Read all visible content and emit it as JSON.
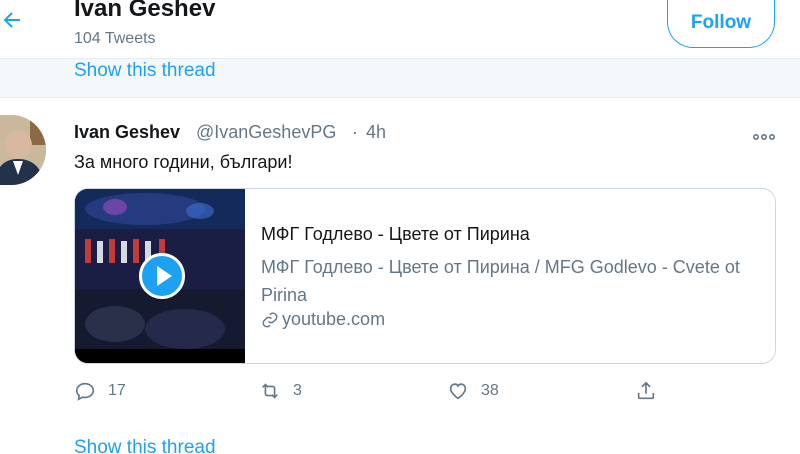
{
  "header": {
    "name": "Ivan Geshev",
    "tweet_count": "104 Tweets",
    "follow_label": "Follow"
  },
  "thread": {
    "show_thread_label": "Show this thread"
  },
  "tweet": {
    "name": "Ivan Geshev",
    "handle": "@IvanGeshevPG",
    "separator": "·",
    "time": "4h",
    "text": "За много години, българи!",
    "card": {
      "title": "МФГ Годлево - Цвете от Пирина",
      "description": "МФГ Годлево - Цвете от Пирина / MFG Godlevo - Cvete ot Pirina",
      "domain": "youtube.com"
    },
    "actions": {
      "replies": "17",
      "retweets": "3",
      "likes": "38"
    }
  },
  "icons": {
    "back": "arrow-left-icon",
    "more": "more-horizontal-icon",
    "play": "play-icon",
    "link": "link-icon",
    "reply": "reply-icon",
    "retweet": "retweet-icon",
    "like": "heart-icon",
    "share": "share-icon"
  },
  "colors": {
    "accent": "#1da1f2",
    "secondary_text": "#657786",
    "band": "#f5f8fa"
  }
}
